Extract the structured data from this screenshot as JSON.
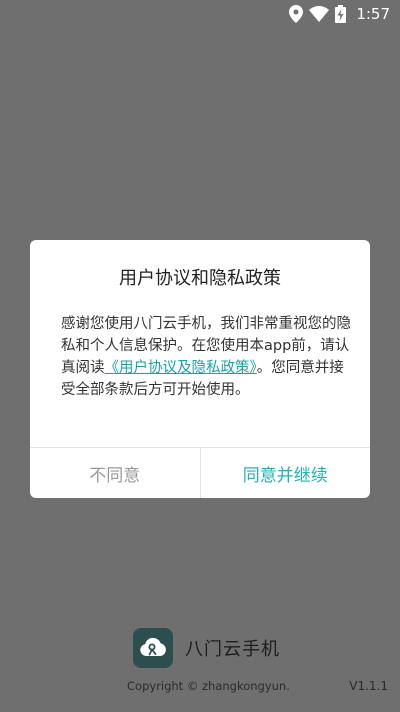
{
  "status_bar": {
    "time": "1:57",
    "icons": [
      "location-icon",
      "wifi-icon",
      "battery-charging-icon"
    ]
  },
  "dialog": {
    "title": "用户协议和隐私政策",
    "body_pre": "感谢您使用八门云手机，我们非常重视您的隐私和个人信息保护。在您使用本app前，请认真阅读",
    "body_link": "《用户协议及隐私政策》",
    "body_post": "。您同意并接受全部条款后方可开始使用。",
    "disagree_label": "不同意",
    "agree_label": "同意并继续"
  },
  "app": {
    "name": "八门云手机",
    "copyright": "Copyright © zhangkongyun.",
    "version": "V1.1.1",
    "logo_icon": "cloud-logo-icon"
  },
  "colors": {
    "overlay": "#6f6f6f",
    "accent": "#25b1b1",
    "link": "#1aa3a3",
    "disagree": "#9a9a9a",
    "logo_bg": "#2c4f4e"
  }
}
